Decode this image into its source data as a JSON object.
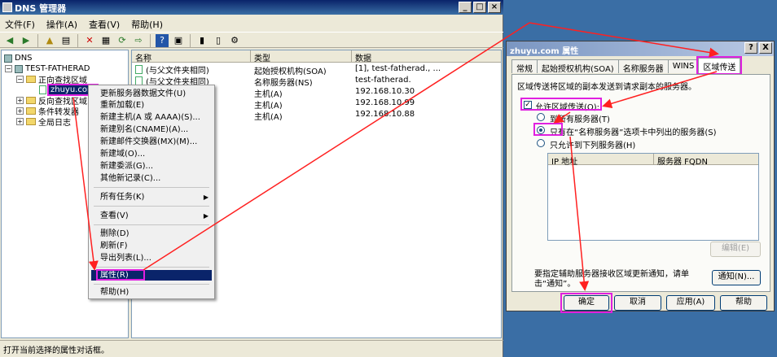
{
  "main": {
    "title": "DNS 管理器",
    "menu": [
      "文件(F)",
      "操作(A)",
      "查看(V)",
      "帮助(H)"
    ],
    "tree": {
      "root": "DNS",
      "server": "TEST-FATHERAD",
      "forward": "正向查找区域",
      "zone": "zhuyu.com",
      "reverse": "反向查找区域",
      "forwarders": "条件转发器",
      "logs": "全局日志"
    },
    "list": {
      "headers": [
        "名称",
        "类型",
        "数据"
      ],
      "rows": [
        {
          "name": "(与父文件夹相同)",
          "type": "起始授权机构(SOA)",
          "data": "[1], test-fatherad., ..."
        },
        {
          "name": "(与父文件夹相同)",
          "type": "名称服务器(NS)",
          "data": "test-fatherad."
        },
        {
          "name": "",
          "type": "主机(A)",
          "data": "192.168.10.30"
        },
        {
          "name": "",
          "type": "主机(A)",
          "data": "192.168.10.99"
        },
        {
          "name": "",
          "type": "主机(A)",
          "data": "192.168.10.88"
        }
      ]
    },
    "status": "打开当前选择的属性对话框。"
  },
  "context_menu": {
    "items": [
      "更新服务器数据文件(U)",
      "重新加载(E)",
      "新建主机(A 或 AAAA)(S)...",
      "新建别名(CNAME)(A)...",
      "新建邮件交换器(MX)(M)...",
      "新建域(O)...",
      "新建委派(G)...",
      "其他新记录(C)..."
    ],
    "all_tasks": "所有任务(K)",
    "view": "查看(V)",
    "edit_items": [
      "删除(D)",
      "刷新(F)",
      "导出列表(L)..."
    ],
    "properties": "属性(R)",
    "help": "帮助(H)"
  },
  "dialog": {
    "title": "zhuyu.com 属性",
    "tabs": [
      "常规",
      "起始授权机构(SOA)",
      "名称服务器",
      "WINS",
      "区域传送"
    ],
    "description": "区域传送将区域的副本发送到请求副本的服务器。",
    "allow_label": "允许区域传送(O):",
    "opt_any": "到所有服务器(T)",
    "opt_ns": "只有在“名称服务器”选项卡中列出的服务器(S)",
    "opt_list": "只允许到下列服务器(H)",
    "col_ip": "IP 地址",
    "col_fqdn": "服务器 FQDN",
    "edit_btn": "编辑(E)",
    "notify_text": "要指定辅助服务器接收区域更新通知，请单击“通知”。",
    "notify_btn": "通知(N)...",
    "ok": "确定",
    "cancel": "取消",
    "apply": "应用(A)",
    "help": "帮助",
    "help_glyph": "?",
    "close_glyph": "X"
  }
}
